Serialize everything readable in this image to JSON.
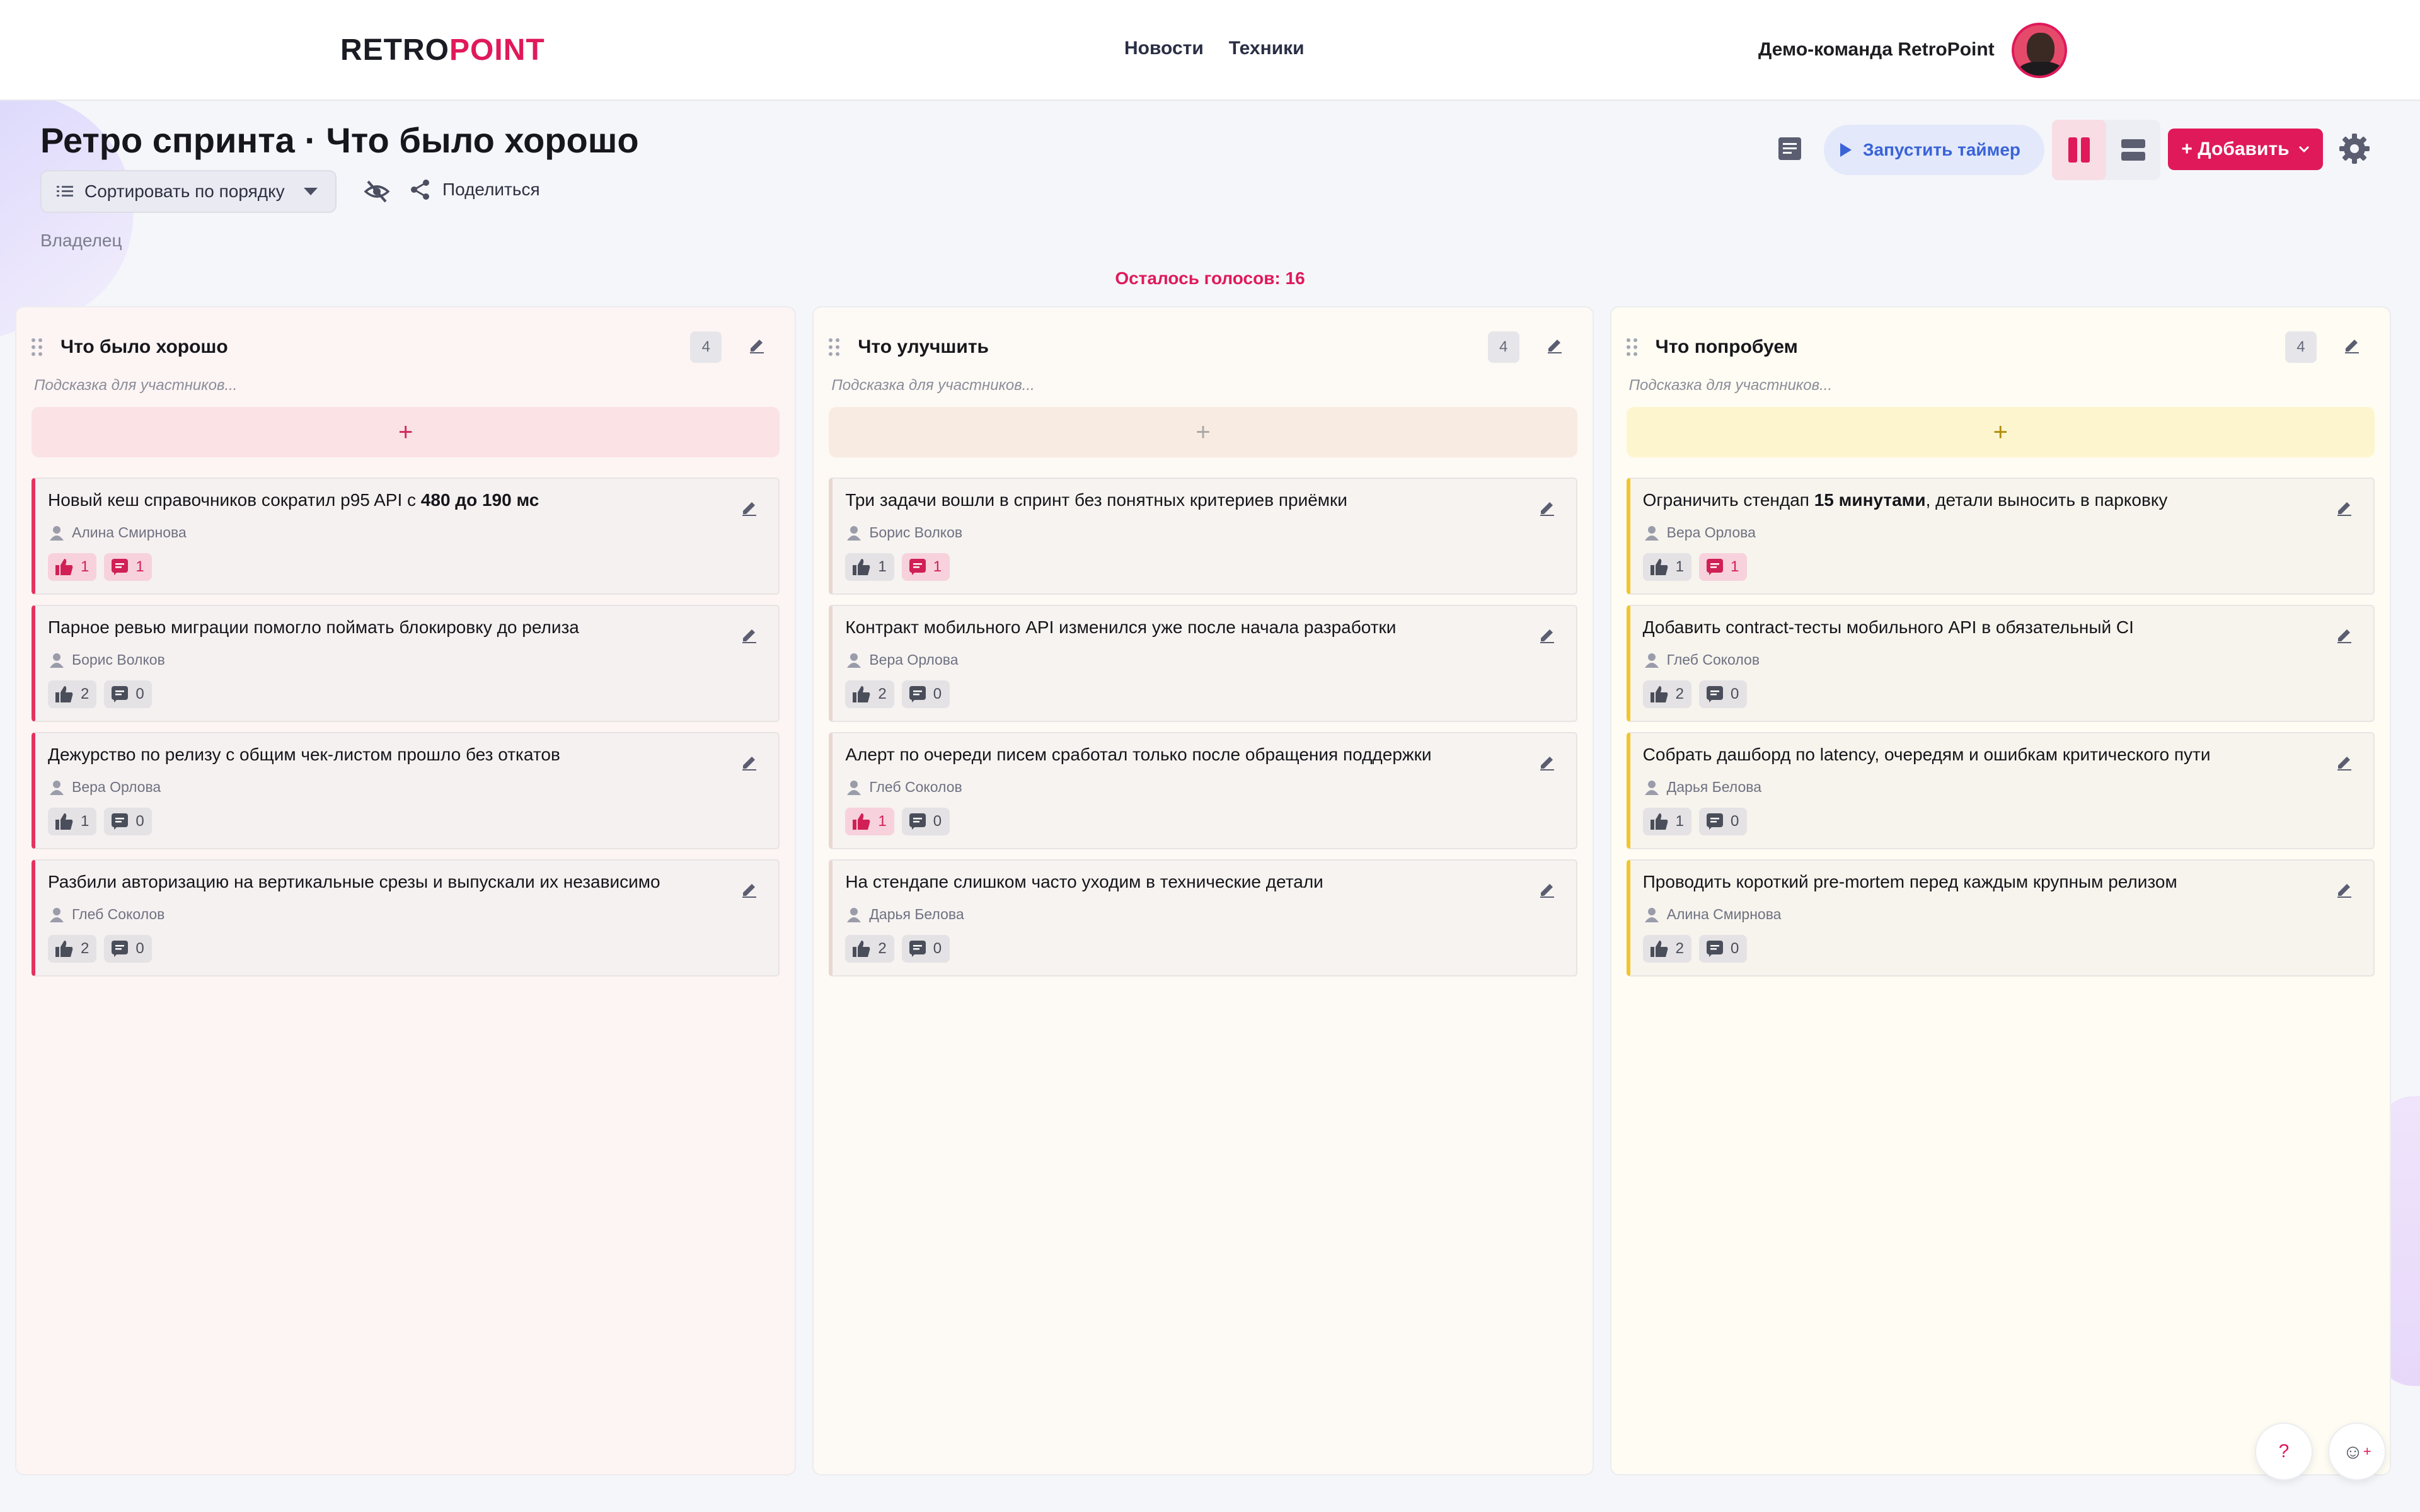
{
  "header": {
    "logo_part1": "RETRO",
    "logo_part2": "POINT",
    "nav": [
      "Новости",
      "Техники"
    ],
    "team_name": "Демо-команда RetroPoint",
    "brand_color": "#e0195a"
  },
  "page": {
    "title": "Ретро спринта · Что было хорошо",
    "sort_label": "Сортировать по порядку",
    "share_label": "Поделиться",
    "owner_label": "Владелец",
    "votes_left": "Осталось голосов: 16"
  },
  "toolbar": {
    "timer_label": "Запустить таймер",
    "add_label": "+ Добавить",
    "icons": [
      "notes-icon",
      "play-icon",
      "columns-view-icon",
      "rows-view-icon",
      "chevron-down-icon",
      "gear-icon"
    ]
  },
  "columns": [
    {
      "title": "Что было хорошо",
      "count": "4",
      "hint": "Подсказка для участников...",
      "add": "+",
      "color": "#e4335f",
      "cards": [
        {
          "text_pre": "Новый кеш справочников сократил p95 API с ",
          "text_bold": "480 до 190 мс",
          "text_post": "",
          "author": "Алина Смирнова",
          "likes": "1",
          "comments": "1",
          "liked": true,
          "commented": true
        },
        {
          "text_pre": "Парное ревью миграции помогло поймать блокировку до релиза",
          "text_bold": "",
          "text_post": "",
          "author": "Борис Волков",
          "likes": "2",
          "comments": "0",
          "liked": false,
          "commented": false
        },
        {
          "text_pre": "Дежурство по релизу с общим чек-листом прошло без откатов",
          "text_bold": "",
          "text_post": "",
          "author": "Вера Орлова",
          "likes": "1",
          "comments": "0",
          "liked": false,
          "commented": false
        },
        {
          "text_pre": "Разбили авторизацию на вертикальные срезы и выпускали их независимо",
          "text_bold": "",
          "text_post": "",
          "author": "Глеб Соколов",
          "likes": "2",
          "comments": "0",
          "liked": false,
          "commented": false
        }
      ]
    },
    {
      "title": "Что улучшить",
      "count": "4",
      "hint": "Подсказка для участников...",
      "add": "+",
      "color": "#e8d8cf",
      "cards": [
        {
          "text_pre": "Три задачи вошли в спринт без понятных критериев приёмки",
          "text_bold": "",
          "text_post": "",
          "author": "Борис Волков",
          "likes": "1",
          "comments": "1",
          "liked": false,
          "commented": true
        },
        {
          "text_pre": "Контракт мобильного API изменился уже после начала разработки",
          "text_bold": "",
          "text_post": "",
          "author": "Вера Орлова",
          "likes": "2",
          "comments": "0",
          "liked": false,
          "commented": false
        },
        {
          "text_pre": "Алерт по очереди писем сработал только после обращения поддержки",
          "text_bold": "",
          "text_post": "",
          "author": "Глеб Соколов",
          "likes": "1",
          "comments": "0",
          "liked": true,
          "commented": false
        },
        {
          "text_pre": "На стендапе слишком часто уходим в технические детали",
          "text_bold": "",
          "text_post": "",
          "author": "Дарья Белова",
          "likes": "2",
          "comments": "0",
          "liked": false,
          "commented": false
        }
      ]
    },
    {
      "title": "Что попробуем",
      "count": "4",
      "hint": "Подсказка для участников...",
      "add": "+",
      "color": "#f2c52c",
      "cards": [
        {
          "text_pre": "Ограничить стендап ",
          "text_bold": "15 минутами",
          "text_post": ", детали выносить в парковку",
          "author": "Вера Орлова",
          "likes": "1",
          "comments": "1",
          "liked": false,
          "commented": true
        },
        {
          "text_pre": "Добавить contract-тесты мобильного API в обязательный CI",
          "text_bold": "",
          "text_post": "",
          "author": "Глеб Соколов",
          "likes": "2",
          "comments": "0",
          "liked": false,
          "commented": false
        },
        {
          "text_pre": "Собрать дашборд по latency, очередям и ошибкам критического пути",
          "text_bold": "",
          "text_post": "",
          "author": "Дарья Белова",
          "likes": "1",
          "comments": "0",
          "liked": false,
          "commented": false
        },
        {
          "text_pre": "Проводить короткий pre-mortem перед каждым крупным релизом",
          "text_bold": "",
          "text_post": "",
          "author": "Алина Смирнова",
          "likes": "2",
          "comments": "0",
          "liked": false,
          "commented": false
        }
      ]
    }
  ],
  "fabs": {
    "help": "?",
    "emoji": "☺",
    "emoji_plus": "+"
  }
}
